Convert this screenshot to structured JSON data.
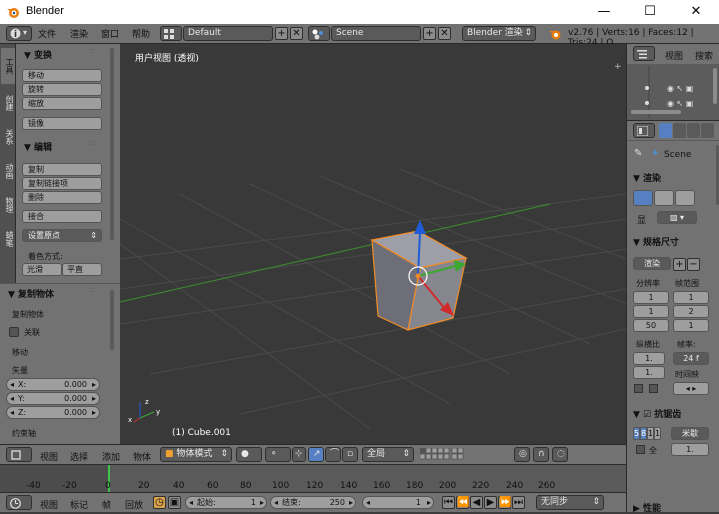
{
  "window": {
    "title": "Blender",
    "minimize": "—",
    "maximize": "☐",
    "close": "✕"
  },
  "info_header": {
    "menus": [
      "文件",
      "渲染",
      "窗口",
      "帮助"
    ],
    "screen_layout": "Default",
    "scene": "Scene",
    "engine": "Blender 渲染",
    "stats": "v2.76 | Verts:16 | Faces:12 | Tris:24 | O"
  },
  "tool_tabs": [
    "工具",
    "创建",
    "关系",
    "动画",
    "物理",
    "蜡笔"
  ],
  "tool_shelf": {
    "transform_header": "▼ 变换",
    "transform_buttons": [
      "移动",
      "旋转",
      "缩放"
    ],
    "mirror_button": "镜像",
    "edit_header": "▼ 编辑",
    "edit_buttons": [
      "复制",
      "复制链接项",
      "删除"
    ],
    "join_button": "接合",
    "set_origin": "设置原点",
    "shading_label": "着色方式:",
    "shade_smooth": "光滑",
    "shade_flat": "平直"
  },
  "redo_panel": {
    "header": "▼ 复制物体",
    "op_name": "复制物体",
    "linked_label": "关联",
    "mode_label": "移动",
    "vector_label": "矢量",
    "fields": [
      {
        "axis": "X:",
        "value": "0.000"
      },
      {
        "axis": "Y:",
        "value": "0.000"
      },
      {
        "axis": "Z:",
        "value": "0.000"
      }
    ],
    "constraint_label": "约束轴"
  },
  "viewport": {
    "view_label": "用户视图 (透视)",
    "object_label": "(1) Cube.001"
  },
  "view3d_header": {
    "menus": [
      "视图",
      "选择",
      "添加",
      "物体"
    ],
    "mode": "物体模式",
    "orientation": "全局"
  },
  "timeline": {
    "ticks": [
      "-40",
      "-20",
      "0",
      "20",
      "40",
      "60",
      "80",
      "100",
      "120",
      "140",
      "160",
      "180",
      "200",
      "220",
      "240",
      "260"
    ],
    "current_frame_position": 0
  },
  "timeline_header": {
    "menus": [
      "视图",
      "标记",
      "帧",
      "回放"
    ],
    "start_label": "起始:",
    "start_value": "1",
    "end_label": "结束:",
    "end_value": "250",
    "current": "1",
    "sync": "无同步"
  },
  "outliner": {
    "view_menu": "视图",
    "search_menu": "搜索",
    "all_scenes": "全"
  },
  "properties": {
    "scene_crumb": "Scene",
    "render_header": "▼ 渲染",
    "display_label": "显",
    "dimensions_header": "▼ 规格尺寸",
    "preset": "渲染",
    "resolution_label": "分辨率",
    "frame_range_label": "帧范围",
    "res_values": [
      "1",
      "1",
      "50"
    ],
    "range_values": [
      "1",
      "2",
      "1"
    ],
    "aspect_label": "纵横比",
    "fps_label": "帧率:",
    "aspect_values": [
      "1.",
      "1."
    ],
    "fps_value": "24 f",
    "time_remap_label": "时间映",
    "aa_header": "▼ ☑ 抗锯齿",
    "aa_samples": [
      "5",
      "8",
      "1",
      "1"
    ],
    "aa_filter": "米歇",
    "full_sample": "全",
    "aa_size": "1.",
    "performance_header": "▶ 性能"
  },
  "colors": {
    "viewport_bg": "#393939",
    "header_bg": "#727272",
    "selection": "#f08c26",
    "x_axis": "#d12a2a",
    "y_axis": "#3da82f",
    "z_axis": "#1e5bd6"
  }
}
